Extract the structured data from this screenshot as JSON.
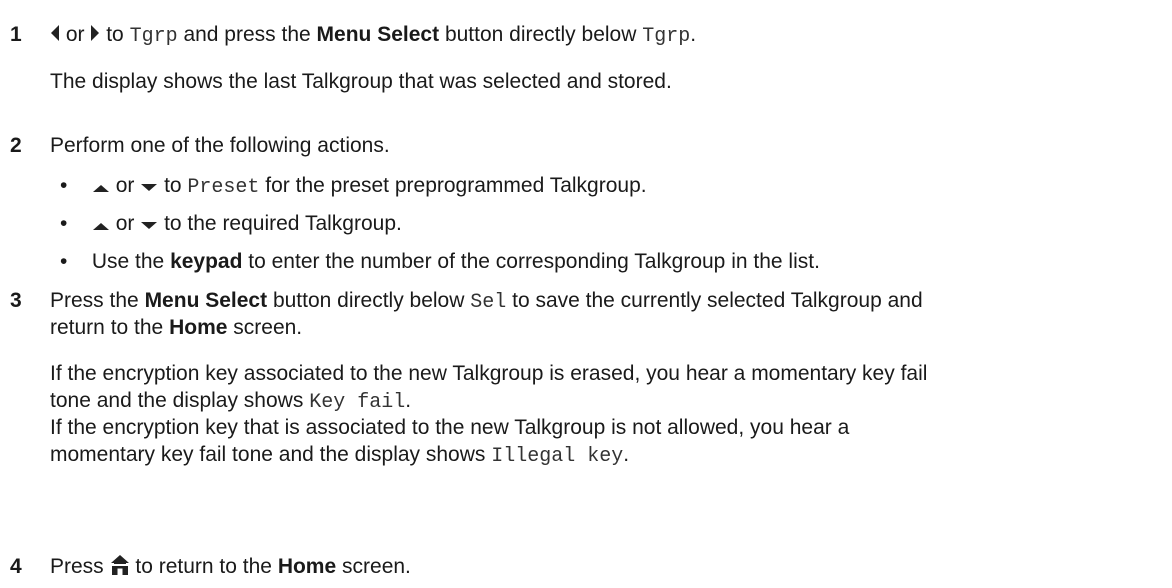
{
  "step1": {
    "number": "1",
    "text_or": "or",
    "text_to": "to",
    "code_tgrp": "Tgrp",
    "text_and_press": "and press the",
    "bold_menu_select": "Menu Select",
    "text_button_below": "button directly below",
    "code_tgrp_2": "Tgrp",
    "period": ".",
    "note": "The display shows the last Talkgroup that was selected and stored."
  },
  "step2": {
    "number": "2",
    "text": "Perform one of the following actions.",
    "bullet1": {
      "or": "or",
      "to": "to",
      "code": "Preset",
      "rest": "for the preset preprogrammed Talkgroup."
    },
    "bullet2": {
      "or": "or",
      "rest": "to the required Talkgroup."
    },
    "bullet3": {
      "pre": "Use the",
      "bold": "keypad",
      "rest": "to enter the number of the corresponding Talkgroup in the list."
    }
  },
  "step3": {
    "number": "3",
    "pre": "Press the",
    "bold_menu_select": "Menu Select",
    "mid": "button directly below",
    "code_sel": "Sel",
    "rest": "to save the currently selected Talkgroup and",
    "line2_pre": "return to the",
    "bold_home": "Home",
    "line2_rest": "screen.",
    "para1_line1": "If the encryption key associated to the new Talkgroup is erased, you hear a momentary key fail",
    "para1_line2_pre": "tone and the display shows",
    "code_key_fail": "Key fail",
    "para1_line2_end": ".",
    "para2_line1": "If the encryption key that is associated to the new Talkgroup is not allowed, you hear a",
    "para2_line2_pre": "momentary key fail tone and the display shows",
    "code_illegal_key": "Illegal key",
    "para2_line2_end": "."
  },
  "step4": {
    "number": "4",
    "pre": "Press",
    "mid": "to return to the",
    "bold_home": "Home",
    "rest": "screen."
  },
  "icons": {
    "left": "left-arrow-icon",
    "right": "right-arrow-icon",
    "up": "up-arrow-icon",
    "down": "down-arrow-icon",
    "home": "home-icon"
  },
  "colors": {
    "text": "#1a1a1a",
    "icon": "#222222"
  }
}
